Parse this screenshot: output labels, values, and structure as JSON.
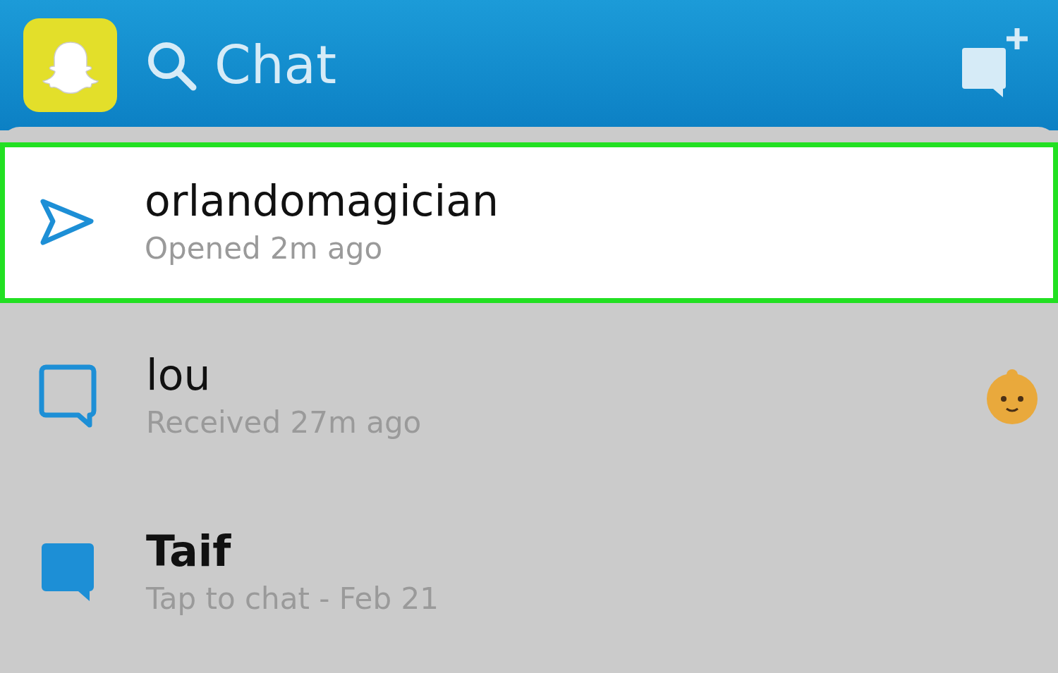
{
  "header": {
    "title": "Chat"
  },
  "chats": [
    {
      "name": "orlandomagician",
      "status": "Opened 2m ago",
      "kind": "sent",
      "highlighted": true,
      "emoji": false
    },
    {
      "name": "lou",
      "status": "Received 27m ago",
      "kind": "received",
      "highlighted": false,
      "emoji": true
    },
    {
      "name": "Taif",
      "status": "Tap to chat - Feb 21",
      "kind": "chat",
      "highlighted": false,
      "emoji": false
    }
  ]
}
